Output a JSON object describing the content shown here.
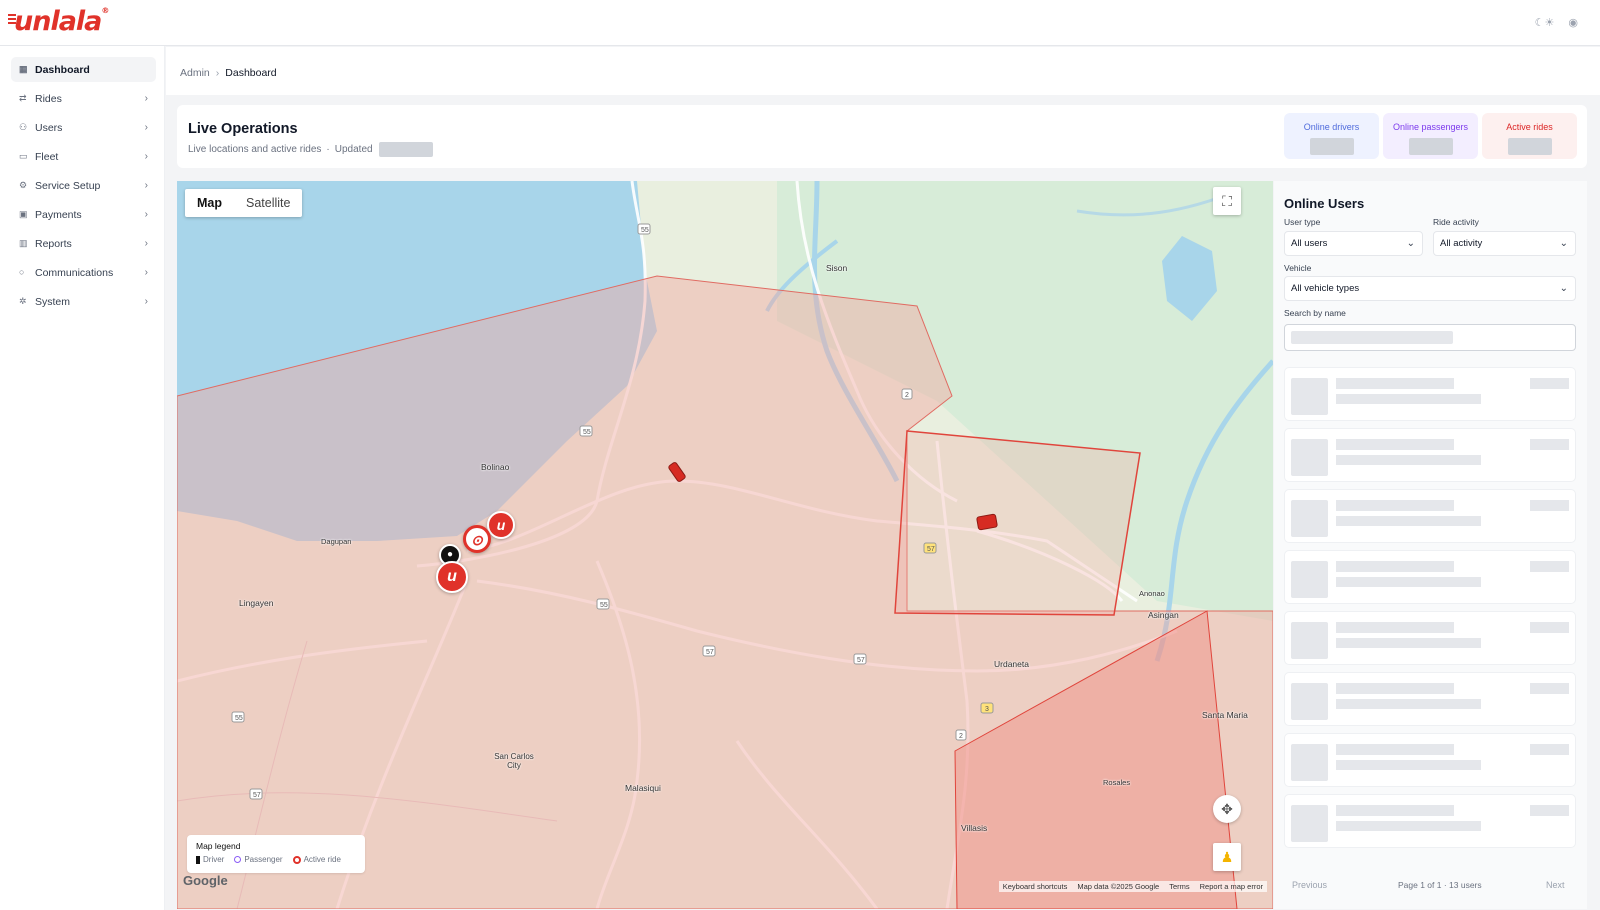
{
  "app": {
    "brand": "unlala"
  },
  "sidebar": {
    "items": [
      {
        "label": "Dashboard",
        "icon": "grid-icon",
        "active": true
      },
      {
        "label": "Rides",
        "icon": "route-icon"
      },
      {
        "label": "Users",
        "icon": "users-icon"
      },
      {
        "label": "Fleet",
        "icon": "car-icon"
      },
      {
        "label": "Service Setup",
        "icon": "settings-grid-icon"
      },
      {
        "label": "Payments",
        "icon": "wallet-icon"
      },
      {
        "label": "Reports",
        "icon": "bar-chart-icon"
      },
      {
        "label": "Communications",
        "icon": "chat-icon"
      },
      {
        "label": "System",
        "icon": "gear-icon"
      }
    ]
  },
  "breadcrumb": {
    "root": "Admin",
    "current": "Dashboard"
  },
  "header": {
    "title": "Live Operations",
    "subtitle": "Live locations and active rides",
    "updated_label": "Updated",
    "stats": [
      {
        "label": "Online drivers",
        "color": "#4f6bdc",
        "bg": "#eef2ff"
      },
      {
        "label": "Online passengers",
        "color": "#7c3aed",
        "bg": "#f3eeff"
      },
      {
        "label": "Active rides",
        "color": "#dc2626",
        "bg": "#fdf0ef"
      }
    ]
  },
  "map": {
    "toggle": {
      "map": "Map",
      "satellite": "Satellite",
      "selected": "Map"
    },
    "places": [
      "Sison",
      "Bolinao",
      "Dagupan",
      "Lingayen",
      "Urdaneta",
      "Asingan",
      "Anonao",
      "Santa Maria",
      "Rosales",
      "Villasis",
      "San Carlos City",
      "Malasiqui"
    ],
    "road_labels": [
      "55",
      "55",
      "2",
      "57",
      "57",
      "55",
      "55",
      "2",
      "3",
      "57",
      "57"
    ],
    "legend": {
      "title": "Map legend",
      "driver": "Driver",
      "passenger": "Passenger",
      "active_ride": "Active ride"
    },
    "google_logo": "Google",
    "attribution": [
      "Keyboard shortcuts",
      "Map data ©2025 Google",
      "Terms",
      "Report a map error"
    ]
  },
  "panel": {
    "title": "Online Users",
    "user_type_label": "User type",
    "user_type_value": "All users",
    "ride_activity_label": "Ride activity",
    "ride_activity_value": "All activity",
    "vehicle_label": "Vehicle",
    "vehicle_value": "All vehicle types",
    "search_label": "Search by name",
    "pager": {
      "previous": "Previous",
      "info": "Page 1 of 1 · 13 users",
      "next": "Next"
    }
  },
  "colors": {
    "brand": "#e0322a",
    "zone_fill": "#f2a9a2",
    "water": "#a8d5ea"
  }
}
